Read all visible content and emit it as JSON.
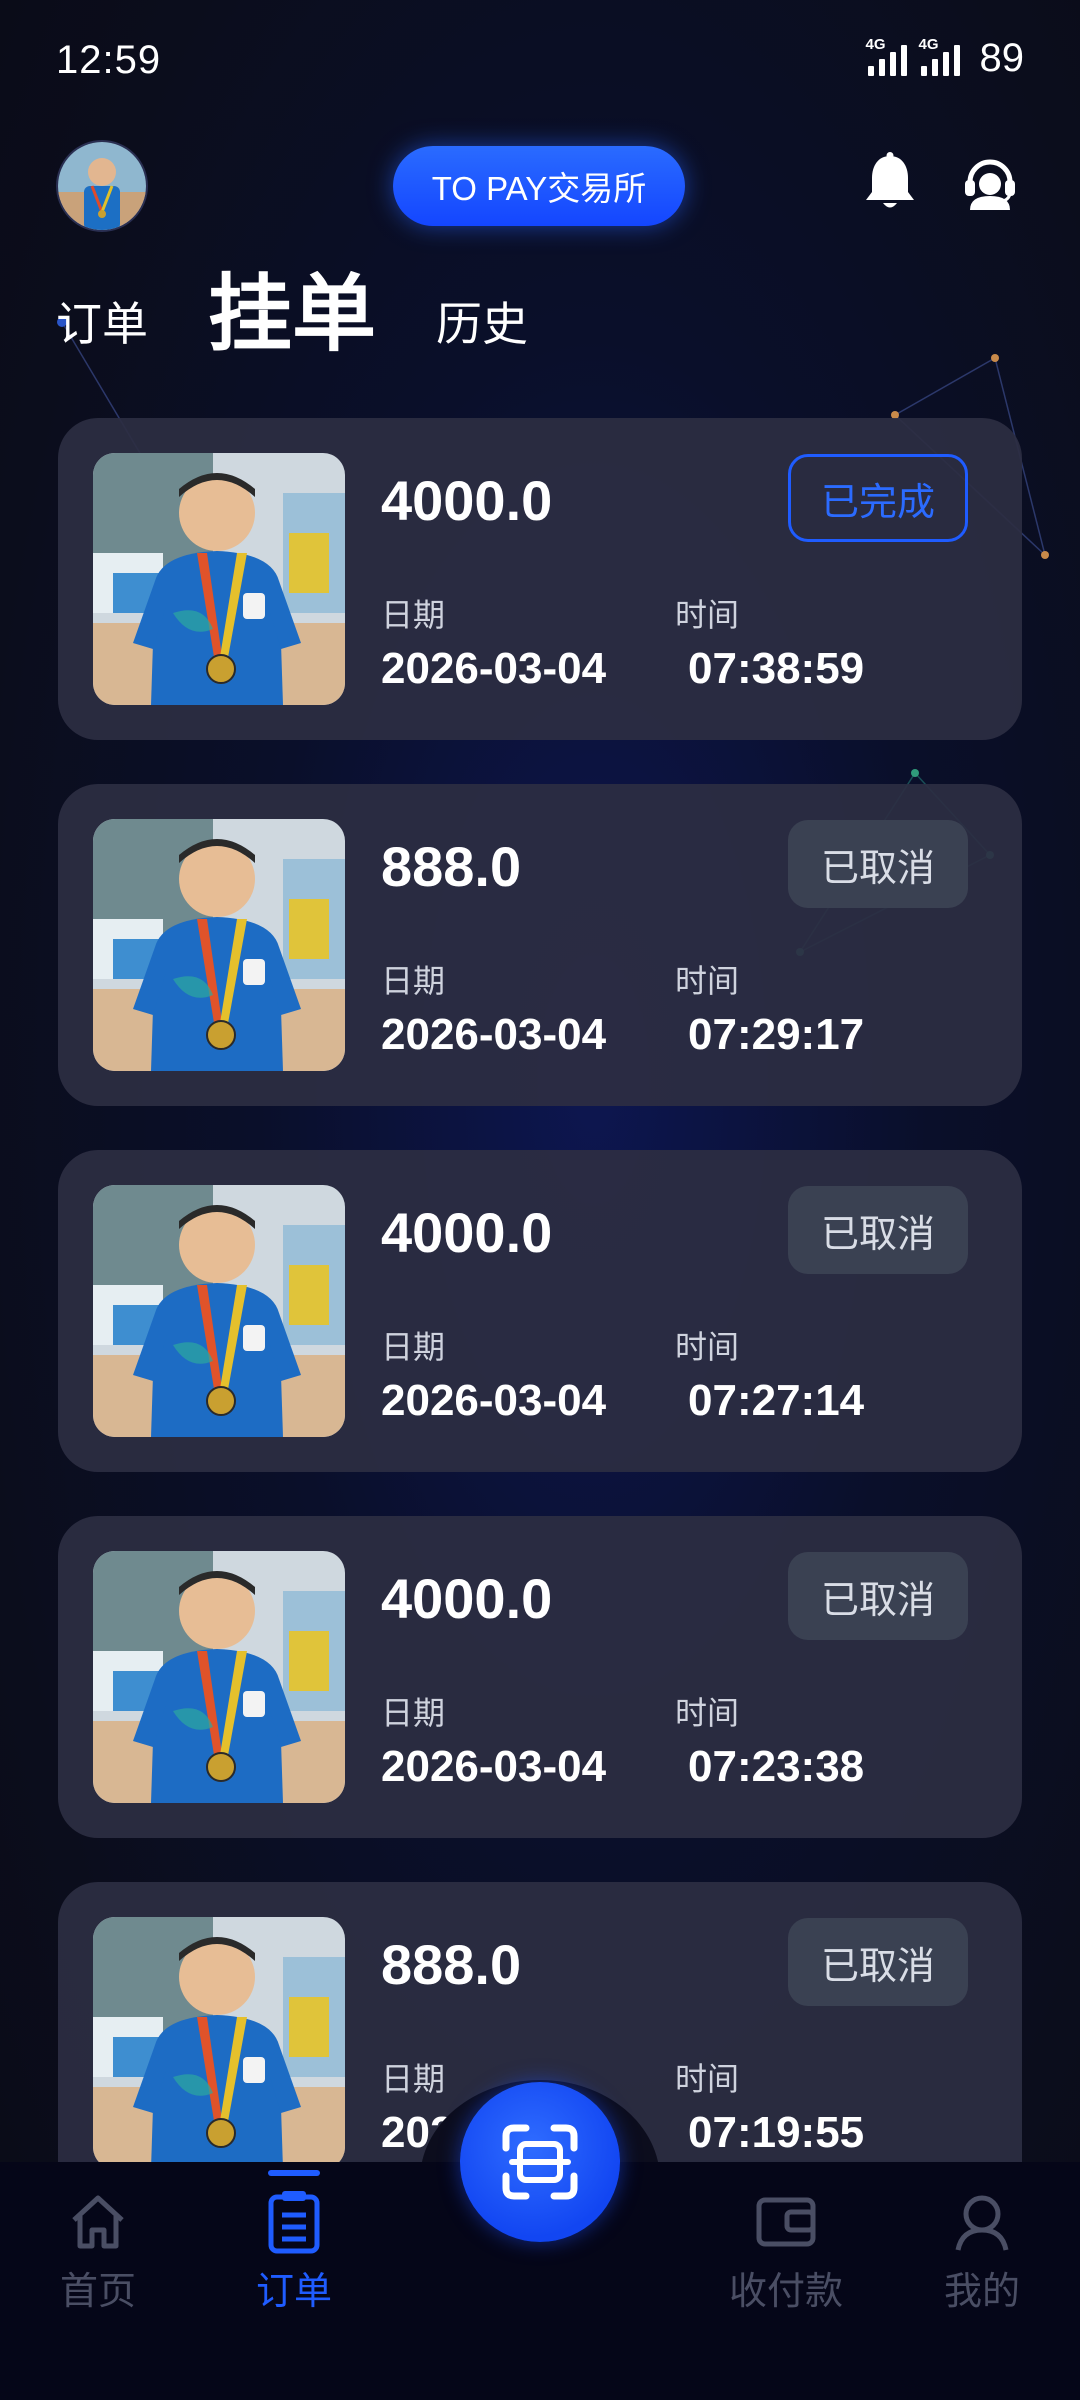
{
  "status_bar": {
    "time": "12:59",
    "network_1": "4G",
    "network_2": "4G",
    "battery": "89"
  },
  "header": {
    "brand": "TO PAY交易所"
  },
  "tabs": [
    {
      "label": "订单",
      "active": false
    },
    {
      "label": "挂单",
      "active": true
    },
    {
      "label": "历史",
      "active": false
    }
  ],
  "labels": {
    "date": "日期",
    "time": "时间"
  },
  "orders": [
    {
      "amount": "4000.0",
      "status": "已完成",
      "date": "2026-03-04",
      "time": "07:38:59"
    },
    {
      "amount": "888.0",
      "status": "已取消",
      "date": "2026-03-04",
      "time": "07:29:17"
    },
    {
      "amount": "4000.0",
      "status": "已取消",
      "date": "2026-03-04",
      "time": "07:27:14"
    },
    {
      "amount": "4000.0",
      "status": "已取消",
      "date": "2026-03-04",
      "time": "07:23:38"
    },
    {
      "amount": "888.0",
      "status": "已取消",
      "date": "2026-03-04",
      "time": "07:19:55"
    }
  ],
  "nav": [
    {
      "label": "首页",
      "icon": "home-icon",
      "active": false
    },
    {
      "label": "订单",
      "icon": "clipboard-icon",
      "active": true
    },
    {
      "label": "收付款",
      "icon": "wallet-icon",
      "active": false
    },
    {
      "label": "我的",
      "icon": "user-icon",
      "active": false
    }
  ],
  "fab": {
    "icon": "scan-icon"
  },
  "colors": {
    "accent": "#1f5cff",
    "card": "#2c2e42",
    "badge_cancel": "#3a4152",
    "nav_inactive": "#4a4e64"
  }
}
